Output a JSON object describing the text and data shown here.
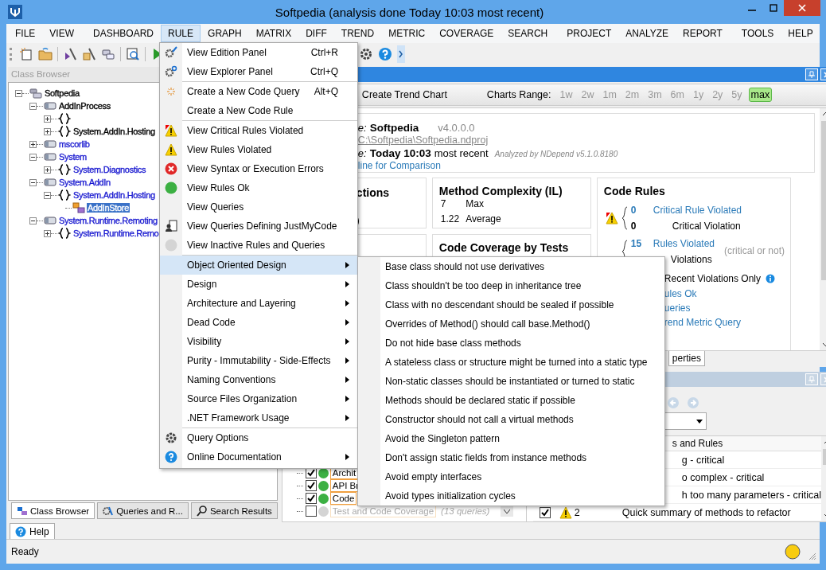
{
  "window": {
    "title": "Softpedia  (analysis done Today 10:03 most recent)"
  },
  "menu_bar": [
    {
      "items": [
        {
          "label": "FILE",
          "selected": false
        },
        {
          "label": "VIEW",
          "selected": false
        }
      ]
    },
    {
      "items": [
        {
          "label": "DASHBOARD",
          "selected": false
        },
        {
          "label": "RULE",
          "selected": true
        },
        {
          "label": "GRAPH",
          "selected": false
        },
        {
          "label": "MATRIX",
          "selected": false
        },
        {
          "label": "DIFF",
          "selected": false
        },
        {
          "label": "TREND",
          "selected": false
        },
        {
          "label": "METRIC",
          "selected": false
        },
        {
          "label": "COVERAGE",
          "selected": false
        },
        {
          "label": "SEARCH",
          "selected": false
        }
      ]
    },
    {
      "items": [
        {
          "label": "PROJECT",
          "selected": false
        },
        {
          "label": "ANALYZE",
          "selected": false
        },
        {
          "label": "REPORT",
          "selected": false
        }
      ]
    },
    {
      "items": [
        {
          "label": "TOOLS",
          "selected": false
        },
        {
          "label": "HELP",
          "selected": false
        }
      ]
    }
  ],
  "class_browser": {
    "title": "Class Browser",
    "tree": [
      {
        "label": "Softpedia",
        "kind": "project",
        "expanded": true,
        "color": "#000000",
        "selected": false,
        "children": [
          {
            "label": "AddInProcess",
            "kind": "assembly",
            "expanded": true,
            "color": "#000000",
            "selected": false,
            "children": [
              {
                "kind": "namespace",
                "expanded": false
              },
              {
                "label": "System.AddIn.Hosting",
                "kind": "namespace",
                "expanded": false,
                "color": "#000000",
                "selected": false
              }
            ]
          },
          {
            "label": "mscorlib",
            "kind": "assembly",
            "expanded": false,
            "color": "#1a1ad0",
            "selected": false
          },
          {
            "label": "System",
            "kind": "assembly",
            "expanded": true,
            "color": "#1a1ad0",
            "selected": false,
            "children": [
              {
                "label": "System.Diagnostics",
                "kind": "namespace",
                "expanded": false,
                "color": "#1a1ad0",
                "selected": false
              }
            ]
          },
          {
            "label": "System.AddIn",
            "kind": "assembly",
            "expanded": true,
            "color": "#1a1ad0",
            "selected": false,
            "children": [
              {
                "label": "System.AddIn.Hosting",
                "kind": "namespace",
                "expanded": true,
                "color": "#1a1ad0",
                "selected": false,
                "children": [
                  {
                    "label": "AddInStore",
                    "kind": "type",
                    "selected": true
                  }
                ]
              }
            ]
          },
          {
            "label": "System.Runtime.Remoting",
            "kind": "assembly",
            "expanded": true,
            "color": "#1a1ad0",
            "selected": false,
            "children": [
              {
                "label": "System.Runtime.Remo",
                "kind": "namespace",
                "expanded": false,
                "color": "#1a1ad0",
                "selected": false
              }
            ]
          }
        ]
      }
    ]
  },
  "left_tabs": [
    {
      "label": "Class Browser",
      "selected": true
    },
    {
      "label": "Queries and R...",
      "selected": false
    },
    {
      "label": "Search Results",
      "selected": false
    }
  ],
  "dashboard": {
    "create_trend": "Create Trend Chart",
    "range_label": "Charts Range:",
    "ranges": [
      {
        "label": "1w",
        "selected": false
      },
      {
        "label": "2w",
        "selected": false
      },
      {
        "label": "1m",
        "selected": false
      },
      {
        "label": "2m",
        "selected": false
      },
      {
        "label": "3m",
        "selected": false
      },
      {
        "label": "6m",
        "selected": false
      },
      {
        "label": "1y",
        "selected": false
      },
      {
        "label": "2y",
        "selected": false
      },
      {
        "label": "5y",
        "selected": false
      },
      {
        "label": "max",
        "selected": true
      }
    ],
    "info": {
      "name_label": "e:",
      "name": "Softpedia",
      "version": "v4.0.0.0",
      "path": "C:\\Softpedia\\Softpedia.ndproj",
      "date_label": "e:",
      "date": "Today 10:03",
      "date_note": "most recent",
      "analyzed": "Analyzed by NDepend v5.1.0.8180",
      "baseline_link": "line for Comparison"
    },
    "card_1": {
      "title": "ctions",
      "value": ")"
    },
    "method_complexity": {
      "title": "Method Complexity (IL)",
      "stats": [
        {
          "number": "7",
          "caption": "Max"
        },
        {
          "number": "1.22",
          "caption": "Average"
        }
      ]
    },
    "code_coverage": {
      "title": "Code Coverage by Tests"
    },
    "code_rules": {
      "title": "Code Rules",
      "critical_count": "0",
      "critical_link": "Critical Rule Violated",
      "critical_violations": "0",
      "critical_violations_label": "Critical Violation",
      "violated_count": "15",
      "violated_link": "Rules Violated",
      "violations_note": "(critical or not)",
      "violations_label": "Violations",
      "recent": "Recent Violations Only",
      "rules_ok_link": "ules Ok",
      "queries_link": "ueries",
      "trend_link": "rend Metric Query"
    },
    "bottom_tab": "perties"
  },
  "queries_panel": {
    "groups": [
      {
        "label": "Archit",
        "checked": true,
        "active": true
      },
      {
        "label": "API Br",
        "checked": true,
        "active": true
      },
      {
        "label": "Code",
        "checked": true,
        "active": true
      },
      {
        "label": "Test and Code Coverage",
        "note": "(13 queries)",
        "checked": false,
        "active": false
      }
    ],
    "table_header": "s and Rules",
    "rows": [
      {
        "text": "g - critical"
      },
      {
        "text": "o complex - critical"
      },
      {
        "text": "h too many parameters - critical"
      },
      {
        "checked": true,
        "kind": "warning",
        "count": "2",
        "text": "Quick summary of methods to refactor"
      }
    ]
  },
  "help_tab": "Help",
  "status_bar": {
    "text": "Ready"
  },
  "rule_menu": {
    "groups": [
      [
        {
          "label": "View Edition Panel",
          "shortcut": "Ctrl+R",
          "kind": "edit"
        },
        {
          "label": "View Explorer Panel",
          "shortcut": "Ctrl+Q",
          "kind": "explore"
        }
      ],
      [
        {
          "label": "Create a New Code Query",
          "shortcut": "Alt+Q",
          "kind": "new"
        },
        {
          "label": "Create a New Code Rule",
          "kind": "none"
        }
      ],
      [
        {
          "label": "View Critical Rules Violated",
          "kind": "critical"
        },
        {
          "label": "View Rules Violated",
          "kind": "warning"
        },
        {
          "label": "View Syntax or Execution Errors",
          "kind": "error"
        },
        {
          "label": "View Rules Ok",
          "kind": "ok"
        },
        {
          "label": "View Queries",
          "kind": "none"
        },
        {
          "label": "View Queries Defining JustMyCode",
          "kind": "justmycode"
        },
        {
          "label": "View Inactive Rules and Queries",
          "kind": "inactive"
        }
      ],
      [
        {
          "label": "Object Oriented Design",
          "kind": "none",
          "submenu": true,
          "selected": true
        },
        {
          "label": "Design",
          "kind": "none",
          "submenu": true,
          "selected": false
        },
        {
          "label": "Architecture and Layering",
          "kind": "none",
          "submenu": true,
          "selected": false
        },
        {
          "label": "Dead Code",
          "kind": "none",
          "submenu": true,
          "selected": false
        },
        {
          "label": "Visibility",
          "kind": "none",
          "submenu": true,
          "selected": false
        },
        {
          "label": "Purity - Immutability - Side-Effects",
          "kind": "none",
          "submenu": true,
          "selected": false
        },
        {
          "label": "Naming Conventions",
          "kind": "none",
          "submenu": true,
          "selected": false
        },
        {
          "label": "Source Files Organization",
          "kind": "none",
          "submenu": true,
          "selected": false
        },
        {
          "label": ".NET Framework Usage",
          "kind": "none",
          "submenu": true,
          "selected": false
        }
      ],
      [
        {
          "label": "Query Options",
          "kind": "options"
        },
        {
          "label": "Online Documentation",
          "kind": "help",
          "submenu": true,
          "selected": false
        }
      ]
    ]
  },
  "submenu": [
    "Base class should not use derivatives",
    "Class shouldn't be too deep in inheritance tree",
    "Class with no descendant should be sealed if possible",
    "Overrides of Method() should call base.Method()",
    "Do not hide base class methods",
    "A stateless class or structure might be turned into a static type",
    "Non-static classes should be instantiated or turned to static",
    "Methods should be declared static if possible",
    "Constructor should not call a virtual methods",
    "Avoid the Singleton pattern",
    "Don't assign static fields from instance methods",
    "Avoid empty interfaces",
    "Avoid types initialization cycles"
  ]
}
